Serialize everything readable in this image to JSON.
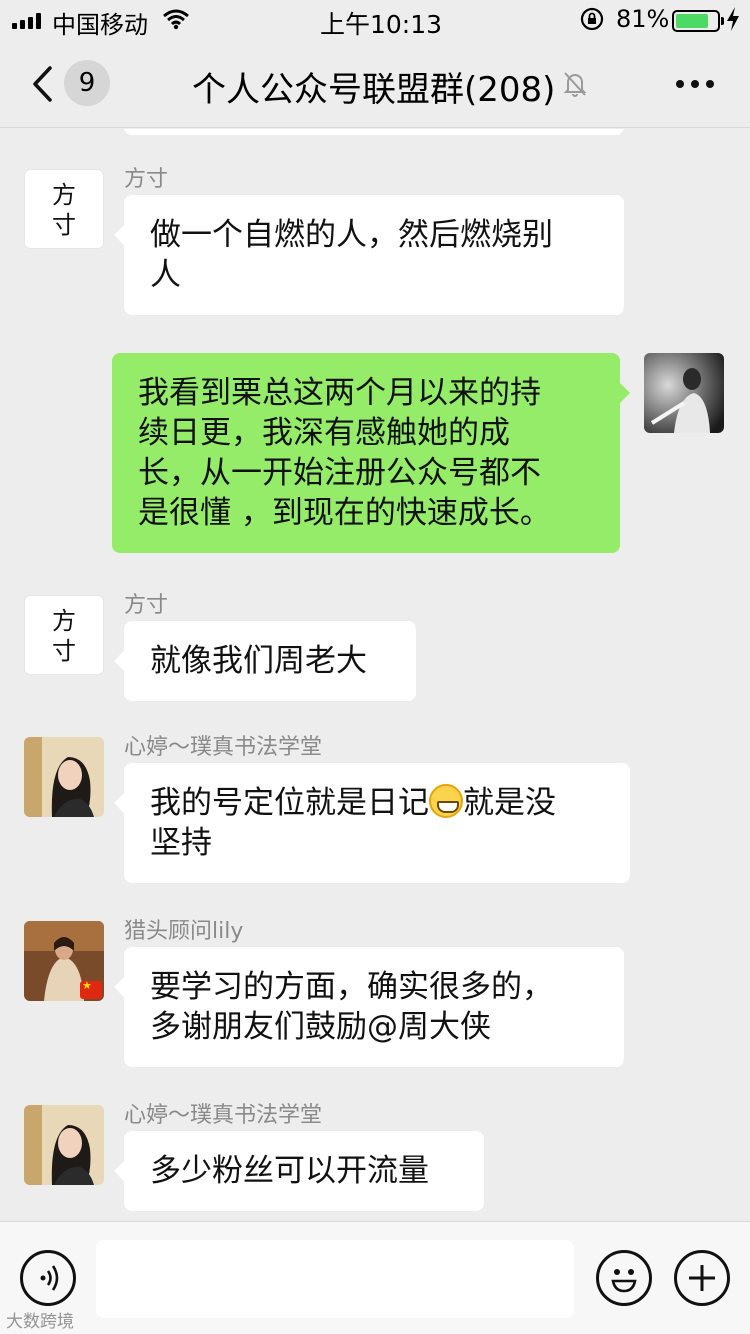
{
  "status_bar": {
    "carrier": "中国移动",
    "time": "上午10:13",
    "battery_percent": "81%",
    "battery_level": 0.81
  },
  "nav": {
    "unread_count": "9",
    "title": "个人公众号联盟群(208)"
  },
  "messages": [
    {
      "sender": "方寸",
      "avatar_text": "方\n寸",
      "text": "做一个自燃的人，然后燃烧别人",
      "line1": "做一个自燃的人，然后燃烧别",
      "line2": "人"
    },
    {
      "sender": "me",
      "lines": [
        "我看到栗总这两个月以来的持",
        "续日更，我深有感触她的成",
        "长，从一开始注册公众号都不",
        "是很懂 ，到现在的快速成长。"
      ]
    },
    {
      "sender": "方寸",
      "avatar_text": "方\n寸",
      "text": "就像我们周老大"
    },
    {
      "sender": "心婷～璞真书法学堂",
      "line1_before": "我的号定位就是日记",
      "emoji": "grin-emoji",
      "line1_after": "就是没",
      "line2": "坚持"
    },
    {
      "sender": "猎头顾问lily",
      "line1": "要学习的方面，确实很多的，",
      "line2": "多谢朋友们鼓励@周大侠"
    },
    {
      "sender": "心婷～璞真书法学堂",
      "text": "多少粉丝可以开流量"
    }
  ],
  "watermark": "大数跨境",
  "icons": {
    "signal": "signal-icon",
    "wifi": "wifi-icon",
    "lock": "orientation-lock-icon",
    "back": "chevron-left-icon",
    "mute": "bell-slash-icon",
    "more": "more-dots-icon",
    "voice": "voice-icon",
    "emoji": "smiley-icon",
    "plus": "plus-icon"
  },
  "colors": {
    "background": "#ededed",
    "my_bubble": "#95ec69",
    "other_bubble": "#ffffff",
    "battery": "#4cd964"
  }
}
